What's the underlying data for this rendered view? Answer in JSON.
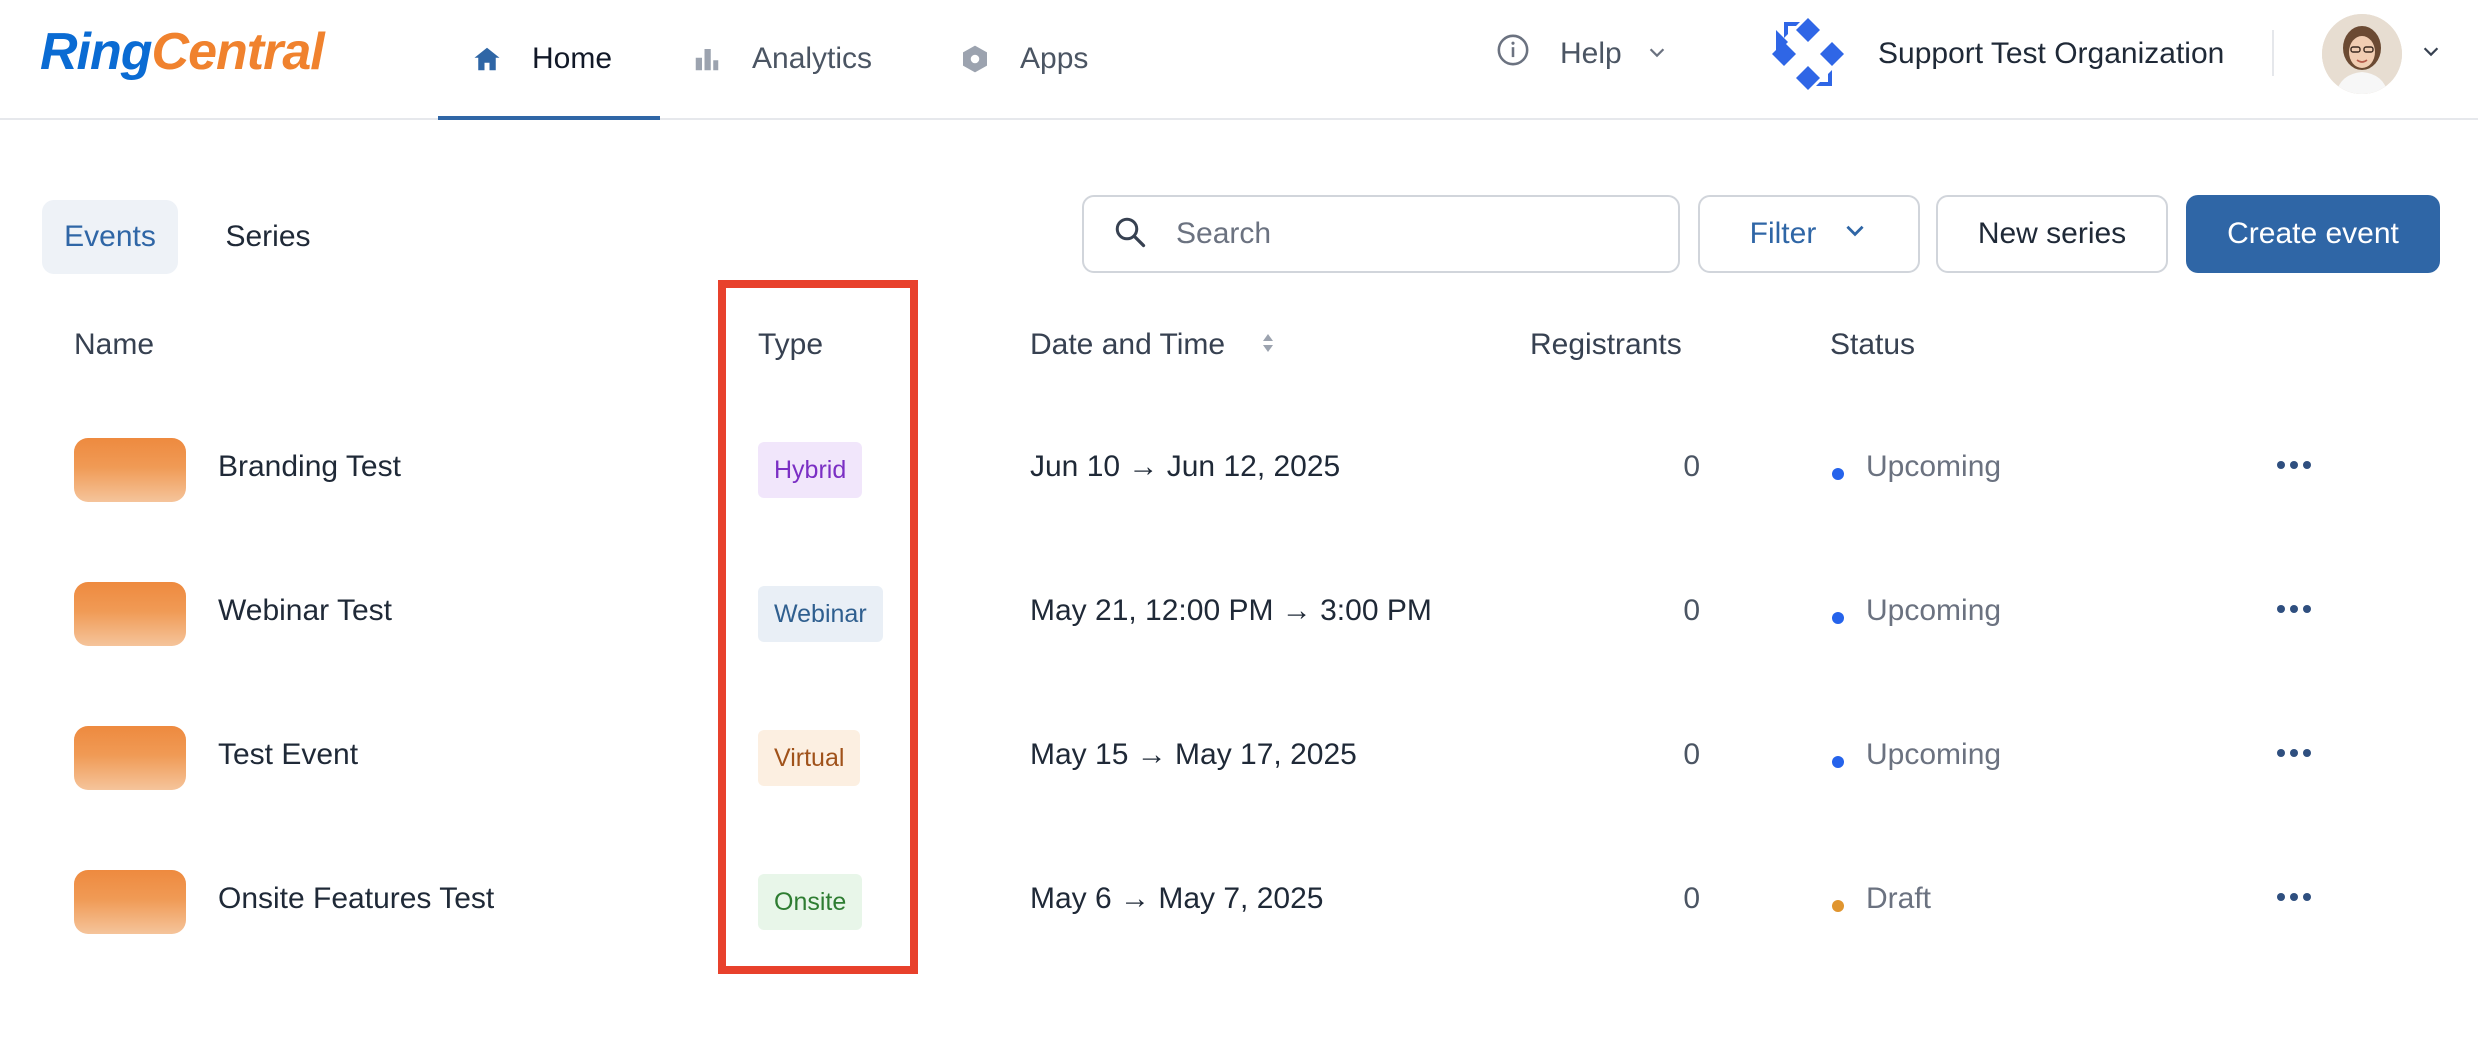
{
  "brand": {
    "logo_ring": "Ring",
    "logo_central": "Central",
    "ring_color": "#0a6bd3",
    "central_color": "#f0822e"
  },
  "nav": {
    "items": [
      {
        "label": "Home",
        "icon": "home-icon",
        "active": true
      },
      {
        "label": "Analytics",
        "icon": "bar-chart-icon",
        "active": false
      },
      {
        "label": "Apps",
        "icon": "hexagon-apps-icon",
        "active": false
      }
    ],
    "help_label": "Help",
    "org_name": "Support Test Organization"
  },
  "tabs": [
    {
      "label": "Events",
      "active": true
    },
    {
      "label": "Series",
      "active": false
    }
  ],
  "search": {
    "placeholder": "Search",
    "value": ""
  },
  "toolbar": {
    "filter_label": "Filter",
    "new_series_label": "New series",
    "create_event_label": "Create event"
  },
  "table": {
    "headers": {
      "name": "Name",
      "type": "Type",
      "date": "Date and Time",
      "registrants": "Registrants",
      "status": "Status"
    },
    "rows": [
      {
        "name": "Branding Test",
        "type": "Hybrid",
        "date": "Jun 10 → Jun 12, 2025",
        "registrants": "0",
        "status": "Upcoming"
      },
      {
        "name": "Webinar Test",
        "type": "Webinar",
        "date": "May 21, 12:00 PM → 3:00 PM",
        "registrants": "0",
        "status": "Upcoming"
      },
      {
        "name": "Test Event",
        "type": "Virtual",
        "date": "May 15 → May 17, 2025",
        "registrants": "0",
        "status": "Upcoming"
      },
      {
        "name": "Onsite Features Test",
        "type": "Onsite",
        "date": "May 6 → May 7, 2025",
        "registrants": "0",
        "status": "Draft"
      }
    ]
  },
  "colors": {
    "accent": "#2f66a6",
    "badge_hybrid_bg": "#f1e6fb",
    "badge_hybrid_fg": "#7b2fc4",
    "badge_webinar_bg": "#e9eff6",
    "badge_webinar_fg": "#2f5f8f",
    "badge_virtual_bg": "#fcefe1",
    "badge_virtual_fg": "#a0521a",
    "badge_onsite_bg": "#e8f6e9",
    "badge_onsite_fg": "#2e7d32",
    "status_upcoming": "#2563eb",
    "status_draft": "#e0952f",
    "highlight": "#e8412c"
  }
}
